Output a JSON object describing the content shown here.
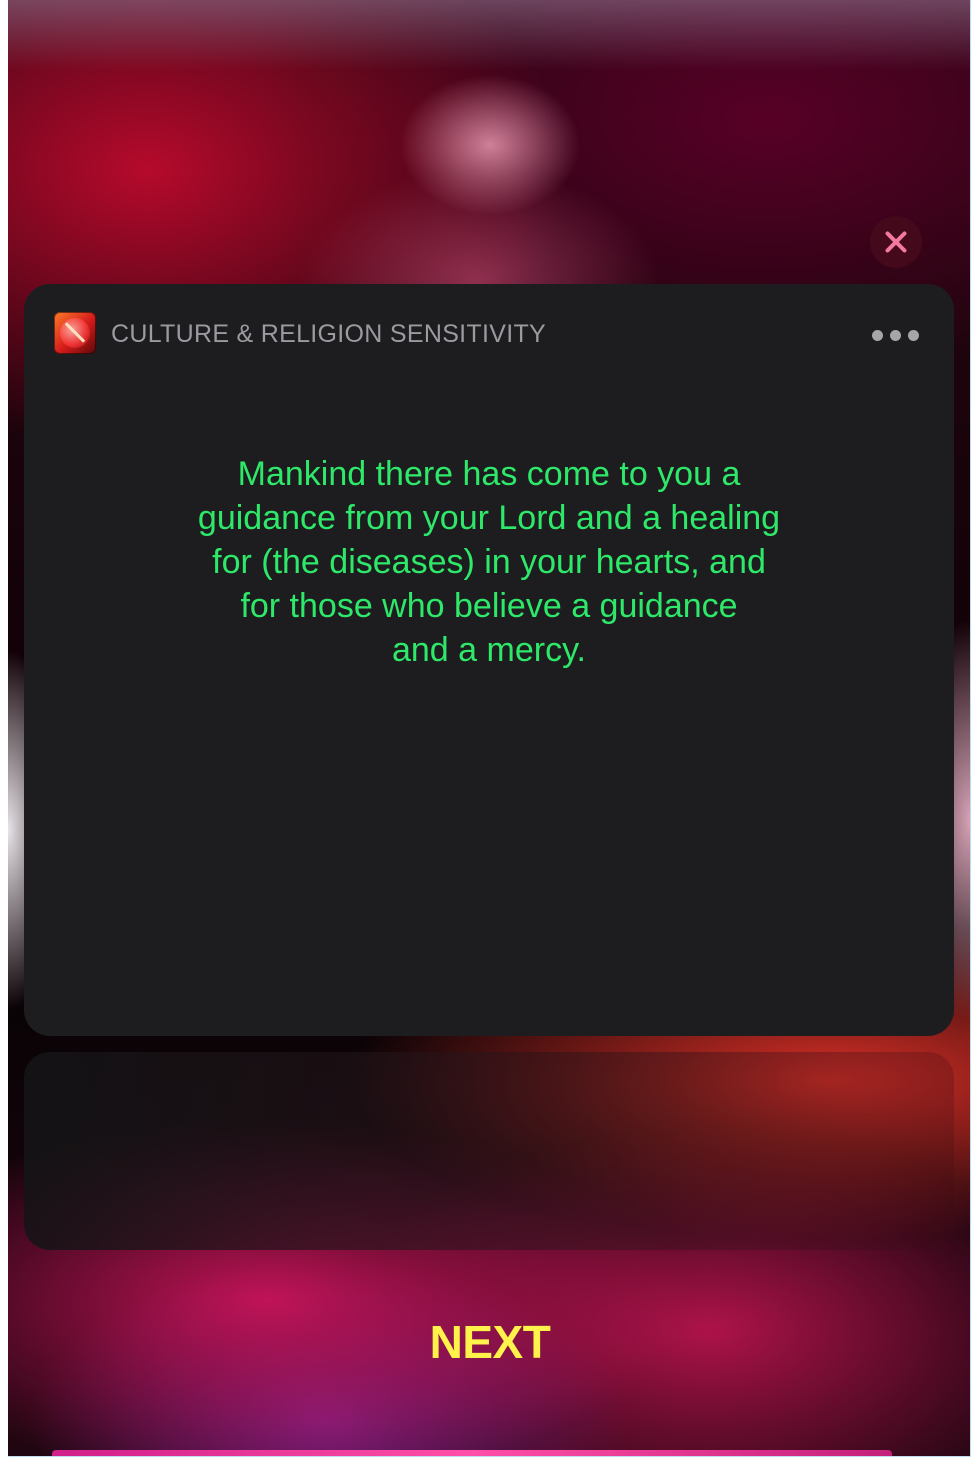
{
  "dialog": {
    "close_icon": "close-icon"
  },
  "card": {
    "app_icon": "culture-religion-app-icon",
    "app_title": "CULTURE & RELIGION SENSITIVITY",
    "more_icon": "ellipsis-icon",
    "message_lines": [
      "Mankind there has come to you a",
      "guidance from your Lord and a healing",
      "for (the diseases) in your hearts, and",
      "for those who believe a guidance",
      "and a mercy."
    ]
  },
  "footer": {
    "next_label": "NEXT"
  },
  "colors": {
    "message_text": "#2ee86a",
    "next_text": "#fff24a",
    "card_bg": "#1d1d1f",
    "close_x": "#f27a9f"
  }
}
